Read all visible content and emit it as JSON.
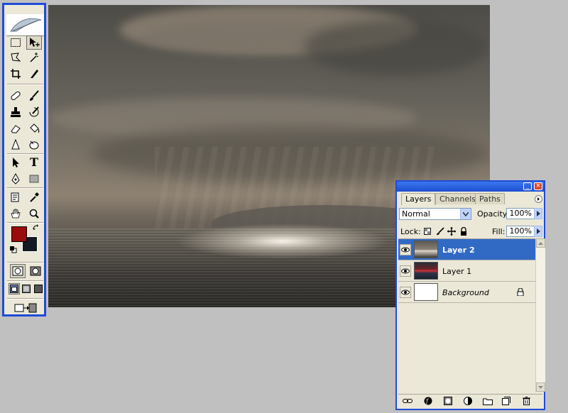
{
  "toolbox": {
    "tools": [
      {
        "name": "rectangular-marquee-icon"
      },
      {
        "name": "move-icon"
      },
      {
        "name": "lasso-icon"
      },
      {
        "name": "magic-wand-icon"
      },
      {
        "name": "crop-icon"
      },
      {
        "name": "slice-icon"
      },
      {
        "name": "healing-brush-icon"
      },
      {
        "name": "brush-icon"
      },
      {
        "name": "clone-stamp-icon"
      },
      {
        "name": "history-brush-icon"
      },
      {
        "name": "eraser-icon"
      },
      {
        "name": "paint-bucket-icon"
      },
      {
        "name": "blur-icon"
      },
      {
        "name": "dodge-icon"
      },
      {
        "name": "path-selection-icon"
      },
      {
        "name": "type-icon"
      },
      {
        "name": "pen-icon"
      },
      {
        "name": "rectangle-shape-icon"
      },
      {
        "name": "notes-icon"
      },
      {
        "name": "eyedropper-icon"
      },
      {
        "name": "hand-icon"
      },
      {
        "name": "zoom-icon"
      }
    ],
    "type_tool_glyph": "T",
    "foreground_color": "#9b0b0b",
    "background_color": "#141a24"
  },
  "layers_panel": {
    "tabs": [
      {
        "label": "Layers",
        "active": true
      },
      {
        "label": "Channels",
        "active": false
      },
      {
        "label": "Paths",
        "active": false
      }
    ],
    "blend_mode": "Normal",
    "opacity_label": "Opacity:",
    "opacity_value": "100%",
    "lock_label": "Lock:",
    "fill_label": "Fill:",
    "fill_value": "100%",
    "layers": [
      {
        "name": "Layer 2",
        "selected": true,
        "visible": true
      },
      {
        "name": "Layer 1",
        "selected": false,
        "visible": true
      },
      {
        "name": "Background",
        "selected": false,
        "visible": true,
        "locked": true
      }
    ]
  },
  "colors": {
    "accent": "#1f4cd6",
    "selection": "#316ac5",
    "panel_bg": "#ebe8d8"
  }
}
